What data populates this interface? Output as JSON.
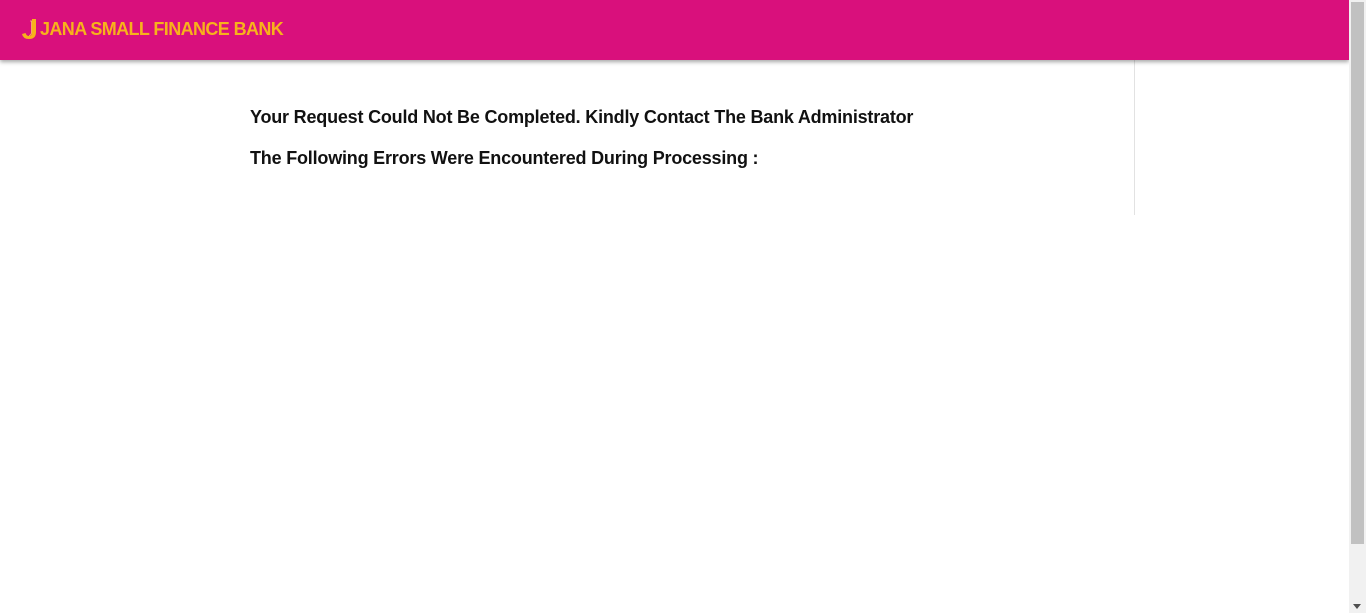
{
  "header": {
    "brand_name": "JANA SMALL FINANCE BANK",
    "brand_mark_icon": "jana-j-logo-icon",
    "background_color": "#d9107c",
    "brand_text_color": "#f7b21b"
  },
  "main": {
    "error_message": "Your Request Could Not Be Completed. Kindly Contact The Bank Administrator",
    "errors_heading": "The Following Errors Were Encountered During Processing :"
  },
  "scrollbar": {
    "down_arrow_icon": "chevron-down-icon"
  }
}
